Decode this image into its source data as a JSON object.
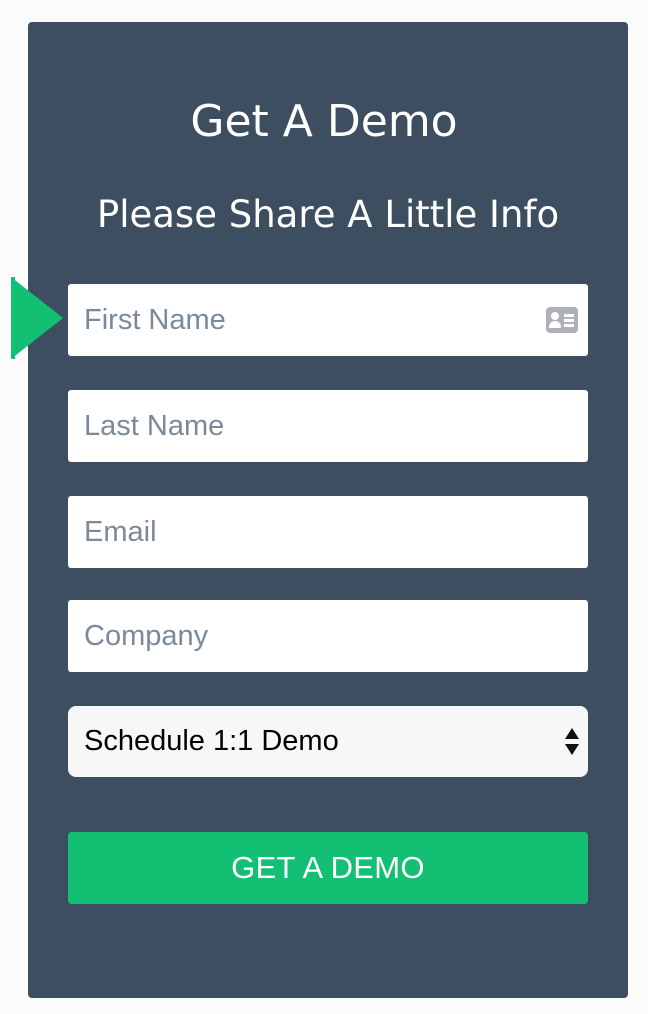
{
  "form": {
    "title": "Get A Demo",
    "subtitle": "Please Share A Little Info",
    "fields": {
      "first_name": {
        "placeholder": "First Name",
        "value": ""
      },
      "last_name": {
        "placeholder": "Last Name",
        "value": ""
      },
      "email": {
        "placeholder": "Email",
        "value": ""
      },
      "company": {
        "placeholder": "Company",
        "value": ""
      }
    },
    "demo_type": {
      "selected": "Schedule 1:1 Demo"
    },
    "submit_label": "GET A DEMO"
  },
  "icons": {
    "pointer": "arrow-right-icon",
    "autofill": "contact-card-icon",
    "select": "select-arrows-icon"
  },
  "colors": {
    "panel_background": "#3d4e60",
    "accent_green": "#13bf73",
    "placeholder_text": "#7b8a9a",
    "page_background": "#fbfbfb"
  }
}
